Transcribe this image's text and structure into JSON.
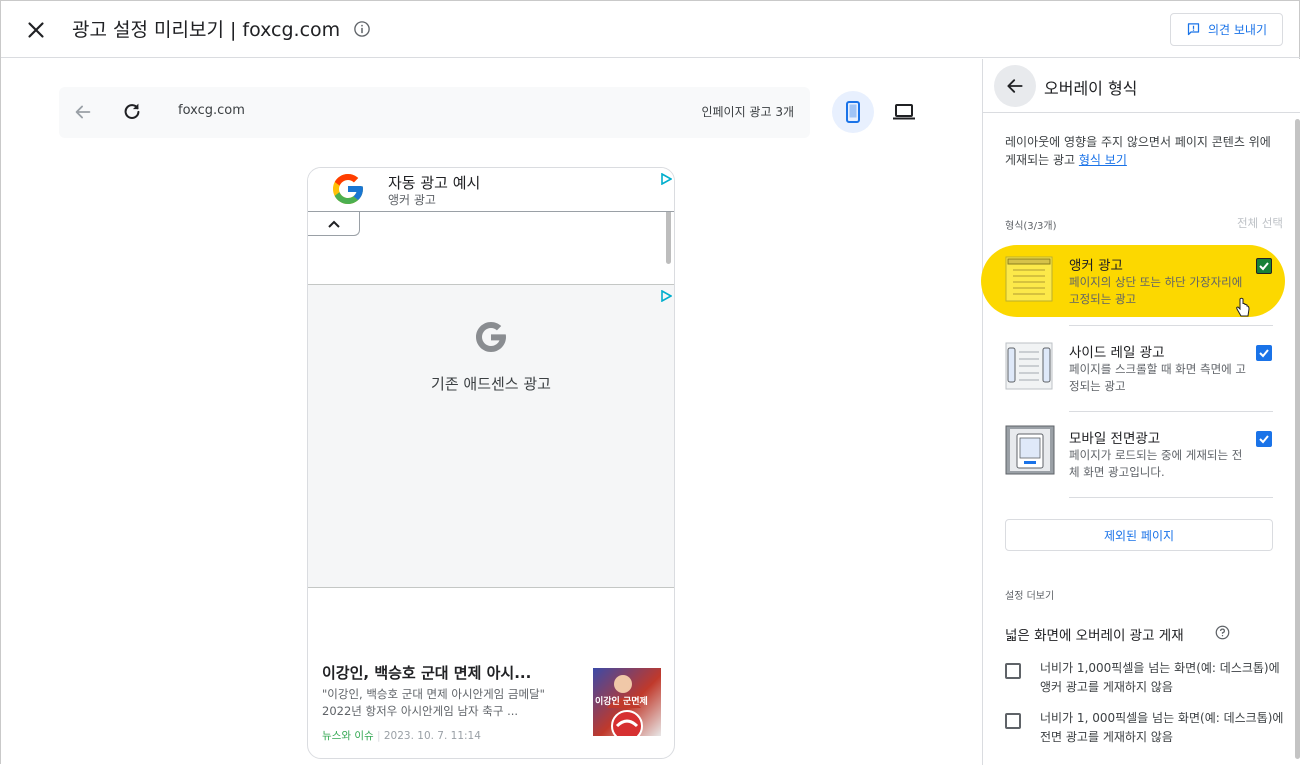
{
  "header": {
    "title": "광고 설정 미리보기 | foxcg.com",
    "feedback_label": "의견 보내기"
  },
  "preview": {
    "url": "foxcg.com",
    "inpage_ads": "인페이지 광고 3개",
    "anchor_ad": {
      "title": "자동 광고 예시",
      "subtitle": "앵커 광고"
    },
    "classic_ad_label": "기존 애드센스 광고",
    "news": {
      "title": "이강인, 백승호 군대 면제 아시...",
      "snippet": "\"이강인, 백승호 군대 면제 아시안게임 금메달\" 2022년 항저우 아시안게임 남자 축구 ...",
      "source": "뉴스와 이슈",
      "date": "2023. 10. 7. 11:14",
      "thumb_text": "이강인 군면제"
    }
  },
  "panel": {
    "title": "오버레이 형식",
    "description": "레이아웃에 영향을 주지 않으면서 페이지 콘텐츠 위에 게재되는 광고",
    "description_link": "형식 보기",
    "format_count": "형식(3/3개)",
    "select_all": "전체 선택",
    "formats": [
      {
        "title": "앵커 광고",
        "desc": "페이지의 상단 또는 하단 가장자리에 고정되는 광고",
        "checked": true,
        "check_color": "#188038"
      },
      {
        "title": "사이드 레일 광고",
        "desc": "페이지를 스크롤할 때 화면 측면에 고정되는 광고",
        "checked": true,
        "check_color": "#1a73e8"
      },
      {
        "title": "모바일 전면광고",
        "desc": "페이지가 로드되는 중에 게재되는 전체 화면 광고입니다.",
        "checked": true,
        "check_color": "#1a73e8"
      }
    ],
    "excluded_pages": "제외된 페이지",
    "more_settings": "설정 더보기",
    "wide_screen_title": "넓은 화면에 오버레이 광고 게재",
    "options": [
      {
        "label": "너비가 1,000픽셀을 넘는 화면(예: 데스크톱)에 앵커 광고를 게재하지 않음",
        "checked": false
      },
      {
        "label": "너비가 1, 000픽셀을 넘는 화면(예: 데스크톱)에 전면 광고를 게재하지 않음",
        "checked": false
      }
    ]
  },
  "colors": {
    "accent": "#1a73e8",
    "highlight": "#fcd800",
    "check_green": "#188038"
  }
}
